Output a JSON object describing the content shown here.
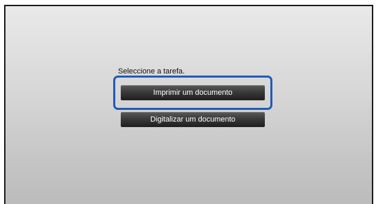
{
  "screen": {
    "prompt": "Seleccione a tarefa.",
    "tasks": [
      {
        "label": "Imprimir um documento",
        "selected": true
      },
      {
        "label": "Digitalizar um documento",
        "selected": false
      }
    ],
    "colors": {
      "focus": "#1f5bb8",
      "button": "#2e2e2e",
      "background": "#d6d6d6"
    }
  }
}
